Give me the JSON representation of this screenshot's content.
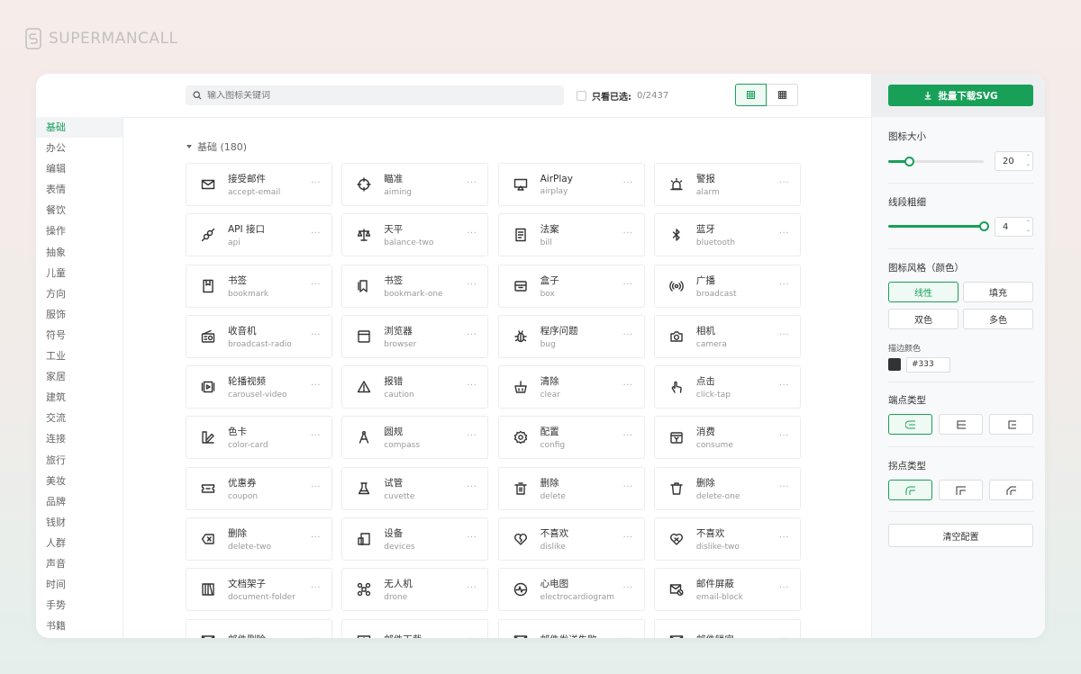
{
  "brand": {
    "name": "SUPERMANCALL"
  },
  "colors": {
    "accent": "#18a058",
    "stroke": "#333333"
  },
  "topbar": {
    "search_placeholder": "输入图标关键词",
    "only_selected_label": "只看已选:",
    "selected_count": "0/2437"
  },
  "categories": [
    "基础",
    "办公",
    "编辑",
    "表情",
    "餐饮",
    "操作",
    "抽象",
    "儿童",
    "方向",
    "服饰",
    "符号",
    "工业",
    "家居",
    "建筑",
    "交流",
    "连接",
    "旅行",
    "美妆",
    "品牌",
    "钱财",
    "人群",
    "声音",
    "时间",
    "手势",
    "书籍"
  ],
  "active_category": "基础",
  "section": {
    "title": "基础 (180)"
  },
  "icons": [
    {
      "zh": "接受邮件",
      "en": "accept-email",
      "icon": "mail-check-icon"
    },
    {
      "zh": "瞄准",
      "en": "aiming",
      "icon": "target-icon"
    },
    {
      "zh": "AirPlay",
      "en": "airplay",
      "icon": "airplay-icon"
    },
    {
      "zh": "警报",
      "en": "alarm",
      "icon": "alarm-icon"
    },
    {
      "zh": "API 接口",
      "en": "api",
      "icon": "api-icon"
    },
    {
      "zh": "天平",
      "en": "balance-two",
      "icon": "balance-icon"
    },
    {
      "zh": "法案",
      "en": "bill",
      "icon": "bill-icon"
    },
    {
      "zh": "蓝牙",
      "en": "bluetooth",
      "icon": "bluetooth-icon"
    },
    {
      "zh": "书签",
      "en": "bookmark",
      "icon": "bookmark-icon"
    },
    {
      "zh": "书签",
      "en": "bookmark-one",
      "icon": "bookmark-one-icon"
    },
    {
      "zh": "盒子",
      "en": "box",
      "icon": "box-icon"
    },
    {
      "zh": "广播",
      "en": "broadcast",
      "icon": "broadcast-icon"
    },
    {
      "zh": "收音机",
      "en": "broadcast-radio",
      "icon": "radio-icon"
    },
    {
      "zh": "浏览器",
      "en": "browser",
      "icon": "browser-icon"
    },
    {
      "zh": "程序问题",
      "en": "bug",
      "icon": "bug-icon"
    },
    {
      "zh": "相机",
      "en": "camera",
      "icon": "camera-icon"
    },
    {
      "zh": "轮播视频",
      "en": "carousel-video",
      "icon": "carousel-video-icon"
    },
    {
      "zh": "报错",
      "en": "caution",
      "icon": "caution-icon"
    },
    {
      "zh": "清除",
      "en": "clear",
      "icon": "clear-icon"
    },
    {
      "zh": "点击",
      "en": "click-tap",
      "icon": "click-tap-icon"
    },
    {
      "zh": "色卡",
      "en": "color-card",
      "icon": "color-card-icon"
    },
    {
      "zh": "圆规",
      "en": "compass",
      "icon": "compass-icon"
    },
    {
      "zh": "配置",
      "en": "config",
      "icon": "config-icon"
    },
    {
      "zh": "消费",
      "en": "consume",
      "icon": "consume-icon"
    },
    {
      "zh": "优惠券",
      "en": "coupon",
      "icon": "coupon-icon"
    },
    {
      "zh": "试管",
      "en": "cuvette",
      "icon": "cuvette-icon"
    },
    {
      "zh": "删除",
      "en": "delete",
      "icon": "delete-icon"
    },
    {
      "zh": "删除",
      "en": "delete-one",
      "icon": "delete-one-icon"
    },
    {
      "zh": "删除",
      "en": "delete-two",
      "icon": "delete-two-icon"
    },
    {
      "zh": "设备",
      "en": "devices",
      "icon": "devices-icon"
    },
    {
      "zh": "不喜欢",
      "en": "dislike",
      "icon": "dislike-icon"
    },
    {
      "zh": "不喜欢",
      "en": "dislike-two",
      "icon": "dislike-two-icon"
    },
    {
      "zh": "文档架子",
      "en": "document-folder",
      "icon": "document-folder-icon"
    },
    {
      "zh": "无人机",
      "en": "drone",
      "icon": "drone-icon"
    },
    {
      "zh": "心电图",
      "en": "electrocardiogram",
      "icon": "ecg-icon"
    },
    {
      "zh": "邮件屏蔽",
      "en": "email-block",
      "icon": "email-block-icon"
    },
    {
      "zh": "邮件删除",
      "en": "",
      "icon": "email-delete-icon"
    },
    {
      "zh": "邮件下载",
      "en": "",
      "icon": "email-download-icon"
    },
    {
      "zh": "邮件发送失败",
      "en": "",
      "icon": "email-fail-icon"
    },
    {
      "zh": "邮件锁定",
      "en": "",
      "icon": "email-lock-icon"
    }
  ],
  "more_glyph": "···",
  "panel": {
    "download_label": "批量下载SVG",
    "size_label": "图标大小",
    "size_value": "20",
    "size_fraction": 0.22,
    "stroke_label": "线段粗细",
    "stroke_value": "4",
    "stroke_fraction": 1.0,
    "style_label": "图标风格（颜色）",
    "styles": [
      "线性",
      "填充",
      "双色",
      "多色"
    ],
    "active_style": "线性",
    "stroke_color_label": "描边颜色",
    "stroke_color_value": "#333",
    "linecap_label": "端点类型",
    "linejoin_label": "拐点类型",
    "clear_label": "清空配置"
  }
}
